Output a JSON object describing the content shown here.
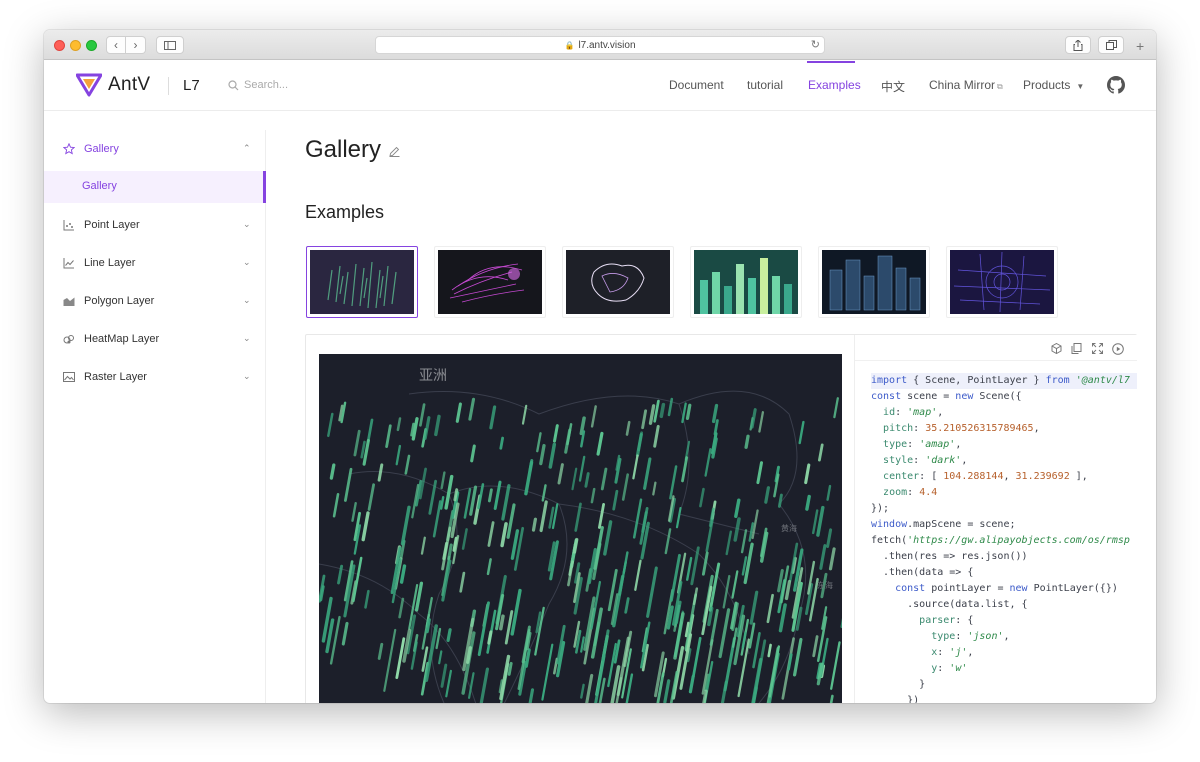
{
  "browser": {
    "url": "l7.antv.vision"
  },
  "header": {
    "logo_text": "AntV",
    "product": "L7",
    "search_placeholder": "Search...",
    "nav": [
      {
        "label": "Document"
      },
      {
        "label": "tutorial"
      },
      {
        "label": "Examples",
        "active": true
      },
      {
        "label": "中文"
      },
      {
        "label": "China Mirror"
      },
      {
        "label": "Products"
      }
    ],
    "accent_color": "#8543e0"
  },
  "sidebar": {
    "items": [
      {
        "label": "Gallery",
        "icon": "star-icon",
        "open": true
      },
      {
        "label": "Point Layer",
        "icon": "point-chart-icon"
      },
      {
        "label": "Line Layer",
        "icon": "line-chart-icon"
      },
      {
        "label": "Polygon Layer",
        "icon": "area-chart-icon"
      },
      {
        "label": "HeatMap Layer",
        "icon": "heatmap-icon"
      },
      {
        "label": "Raster Layer",
        "icon": "image-icon"
      }
    ],
    "sub_item": "Gallery"
  },
  "main": {
    "title": "Gallery",
    "section": "Examples",
    "thumbnails": [
      {
        "name": "lines-3d",
        "active": true
      },
      {
        "name": "flowlines-purple"
      },
      {
        "name": "outline-white"
      },
      {
        "name": "columns-green"
      },
      {
        "name": "buildings-dark"
      },
      {
        "name": "streets-blue"
      }
    ],
    "map_labels": {
      "asia": "亚洲",
      "yellow_sea": "黄海",
      "east_sea": "东海"
    }
  },
  "code": {
    "lines": [
      "import { Scene, PointLayer } from '@antv/l7",
      "const scene = new Scene({",
      "  id: 'map',",
      "  pitch: 35.210526315789465,",
      "  type: 'amap',",
      "  style: 'dark',",
      "  center: [ 104.288144, 31.239692 ],",
      "  zoom: 4.4",
      "});",
      "window.mapScene = scene;",
      "fetch('https://gw.alipayobjects.com/os/rmsp",
      "  .then(res => res.json())",
      "  .then(data => {",
      "    const pointLayer = new PointLayer({})",
      "      .source(data.list, {",
      "        parser: {",
      "          type: 'json',",
      "          x: 'j',",
      "          y: 'w'",
      "        }",
      "      })"
    ]
  }
}
